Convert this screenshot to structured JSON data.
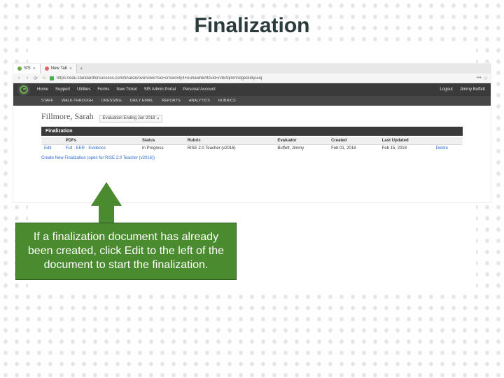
{
  "slide": {
    "title": "Finalization"
  },
  "browser": {
    "tabs": [
      {
        "label": "SfS",
        "favicon": "green"
      },
      {
        "label": "New Tab",
        "favicon": "firefox"
      }
    ],
    "url": "https://edu.standardforsuccess.com/finalize/overview?sid=crSwc5fy4Feu4awhB/9zuid=rv8ctqmmndge9u8yuuq",
    "nav": {
      "items": [
        "Home",
        "Support",
        "Utilities",
        "Forms",
        "New Ticket",
        "SfS Admin Portal",
        "Personal Account"
      ],
      "right": [
        "Logout",
        "Jimmy Buffett"
      ]
    },
    "subnav": [
      "STAFF",
      "WALK-THROUGH",
      "DRESSING",
      "DAILY EMAIL",
      "REPORTS",
      "ANALYTICS",
      "RUBRICS"
    ]
  },
  "person": {
    "name": "Fillmore, Sarah",
    "evaluation_label": "Evaluation Ending Jun 2018"
  },
  "section": {
    "title": "Finalization"
  },
  "table": {
    "headers": [
      "",
      "PDFs",
      "Status",
      "Rubric",
      "Evaluator",
      "Created",
      "Last Updated",
      ""
    ],
    "row": {
      "edit": "Edit",
      "pdfs": "Full · EER · Evidence",
      "status": "In Progress",
      "rubric": "RISE 2.0 Teacher (v2016)",
      "evaluator": "Buffett, Jimmy",
      "created": "Feb 01, 2018",
      "updated": "Feb 15, 2018",
      "delete": "Delete"
    }
  },
  "create_note": "Create New Finalization (open for RISE 2.0 Teacher (v2016))",
  "callout": {
    "text": "If a finalization document has already been created, click Edit to the left of the document  to start the finalization."
  }
}
